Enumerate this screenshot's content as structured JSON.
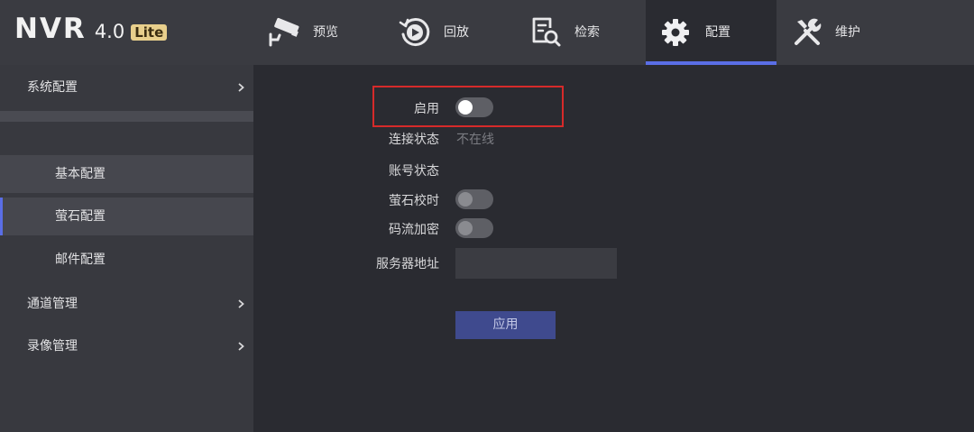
{
  "logo": {
    "name": "NVR",
    "version": "4.0",
    "edition": "Lite"
  },
  "nav": [
    {
      "label": "预览",
      "icon": "camera-icon"
    },
    {
      "label": "回放",
      "icon": "playback-icon"
    },
    {
      "label": "检索",
      "icon": "search-document-icon"
    },
    {
      "label": "配置",
      "icon": "gear-icon"
    },
    {
      "label": "维护",
      "icon": "tools-icon"
    }
  ],
  "sidebar": {
    "system_config": "系统配置",
    "basic_config": "基本配置",
    "ezviz_config": "萤石配置",
    "mail_config": "邮件配置",
    "channel_mgmt": "通道管理",
    "record_mgmt": "录像管理"
  },
  "form": {
    "enable_label": "启用",
    "connection_label": "连接状态",
    "connection_value": "不在线",
    "account_label": "账号状态",
    "account_value": "",
    "time_sync_label": "萤石校时",
    "stream_encrypt_label": "码流加密",
    "server_label": "服务器地址",
    "server_value": ""
  },
  "apply_label": "应用",
  "colors": {
    "accent": "#5a6ee6",
    "highlight": "#d62a2a",
    "header_bg": "#3a3b41",
    "content_bg": "#2a2b31",
    "sidebar_bg": "#38393f"
  }
}
